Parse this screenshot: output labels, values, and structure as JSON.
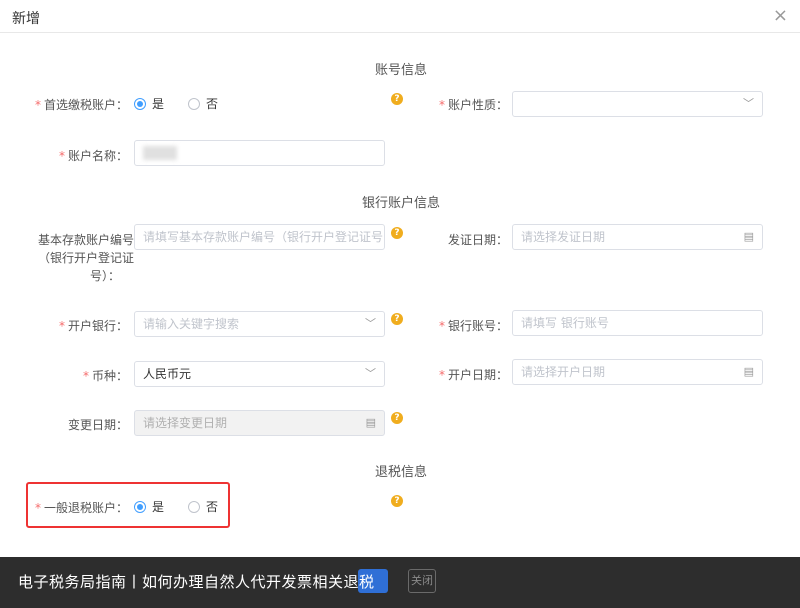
{
  "dialog": {
    "title": "新增",
    "close_glyph": "×"
  },
  "sections": {
    "account_info": "账号信息",
    "bank_info": "银行账户信息",
    "refund_info": "退税信息"
  },
  "fields": {
    "preferred_tax_account": {
      "label": "首选缴税账户：",
      "options": [
        "是",
        "否"
      ],
      "selected": "是"
    },
    "account_nature": {
      "label": "账户性质：",
      "value": ""
    },
    "account_name": {
      "label": "账户名称："
    },
    "basic_deposit_no": {
      "label_lines": [
        "基本存款账户编号",
        "（银行开户登记证",
        "号）："
      ],
      "placeholder": "请填写基本存款账户编号（银行开户登记证号"
    },
    "issue_date": {
      "label": "发证日期：",
      "placeholder": "请选择发证日期"
    },
    "open_bank": {
      "label": "开户银行：",
      "placeholder": "请输入关键字搜索"
    },
    "bank_account_no": {
      "label": "银行账号：",
      "placeholder": "请填写 银行账号"
    },
    "currency": {
      "label": "币种：",
      "value": "人民币元"
    },
    "open_date": {
      "label": "开户日期：",
      "placeholder": "请选择开户日期"
    },
    "change_date": {
      "label": "变更日期：",
      "placeholder": "请选择变更日期"
    },
    "general_refund_account": {
      "label": "一般退税账户：",
      "options": [
        "是",
        "否"
      ],
      "selected": "是"
    }
  },
  "banner": {
    "text": "电子税务局指南丨如何办理自然人代开发票相关退税"
  },
  "footer": {
    "close_label": "关闭"
  },
  "icons": {
    "help": "question-circle-icon",
    "chevron": "chevron-down-icon",
    "calendar": "calendar-icon"
  },
  "colors": {
    "accent": "#409eff",
    "required": "#f56c6c",
    "help": "#f0ad1e",
    "highlight": "#ee3333",
    "banner_bg": "#2d2d2d"
  }
}
